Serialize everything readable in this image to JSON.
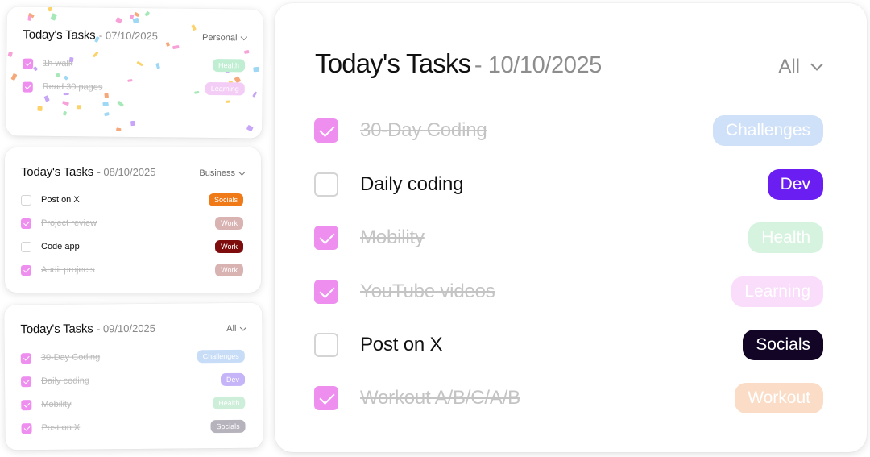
{
  "cards": [
    {
      "title": "Today's Tasks",
      "date": "07/10/2025",
      "filter": "Personal",
      "tasks": [
        {
          "label": "1h walk",
          "done": true,
          "tag": "Health",
          "tag_color": "#bfeed2"
        },
        {
          "label": "Read 30 pages",
          "done": true,
          "tag": "Learning",
          "tag_color": "#f4cdf6"
        }
      ]
    },
    {
      "title": "Today's Tasks",
      "date": "08/10/2025",
      "filter": "Business",
      "tasks": [
        {
          "label": "Post on X",
          "done": false,
          "tag": "Socials",
          "tag_color": "#f07a18"
        },
        {
          "label": "Project review",
          "done": true,
          "tag": "Work",
          "tag_color": "#d9b2b2"
        },
        {
          "label": "Code app",
          "done": false,
          "tag": "Work",
          "tag_color": "#7e0c0c"
        },
        {
          "label": "Audit projects",
          "done": true,
          "tag": "Work",
          "tag_color": "#d9b2b2"
        }
      ]
    },
    {
      "title": "Today's Tasks",
      "date": "09/10/2025",
      "filter": "All",
      "tasks": [
        {
          "label": "30-Day Coding",
          "done": true,
          "tag": "Challenges",
          "tag_color": "#c7dcf7"
        },
        {
          "label": "Daily coding",
          "done": true,
          "tag": "Dev",
          "tag_color": "#c5b4f7"
        },
        {
          "label": "Mobility",
          "done": true,
          "tag": "Health",
          "tag_color": "#cdeed8"
        },
        {
          "label": "Post on X",
          "done": true,
          "tag": "Socials",
          "tag_color": "#b7b3bd"
        }
      ]
    }
  ],
  "main": {
    "title": "Today's Tasks",
    "date": "10/10/2025",
    "filter": "All",
    "tasks": [
      {
        "label": "30-Day Coding",
        "done": true,
        "tag": "Challenges",
        "tag_color": "#cfe0f9"
      },
      {
        "label": "Daily coding",
        "done": false,
        "tag": "Dev",
        "tag_color": "#6b1ef2"
      },
      {
        "label": "Mobility",
        "done": true,
        "tag": "Health",
        "tag_color": "#d6f3df"
      },
      {
        "label": "YouTube videos",
        "done": true,
        "tag": "Learning",
        "tag_color": "#fadcfb"
      },
      {
        "label": "Post on X",
        "done": false,
        "tag": "Socials",
        "tag_color": "#120525"
      },
      {
        "label": "Workout A/B/C/A/B",
        "done": true,
        "tag": "Workout",
        "tag_color": "#fbdcc6"
      }
    ]
  },
  "icons": {
    "checkbox": "check-icon",
    "dropdown": "chevron-down-icon"
  }
}
